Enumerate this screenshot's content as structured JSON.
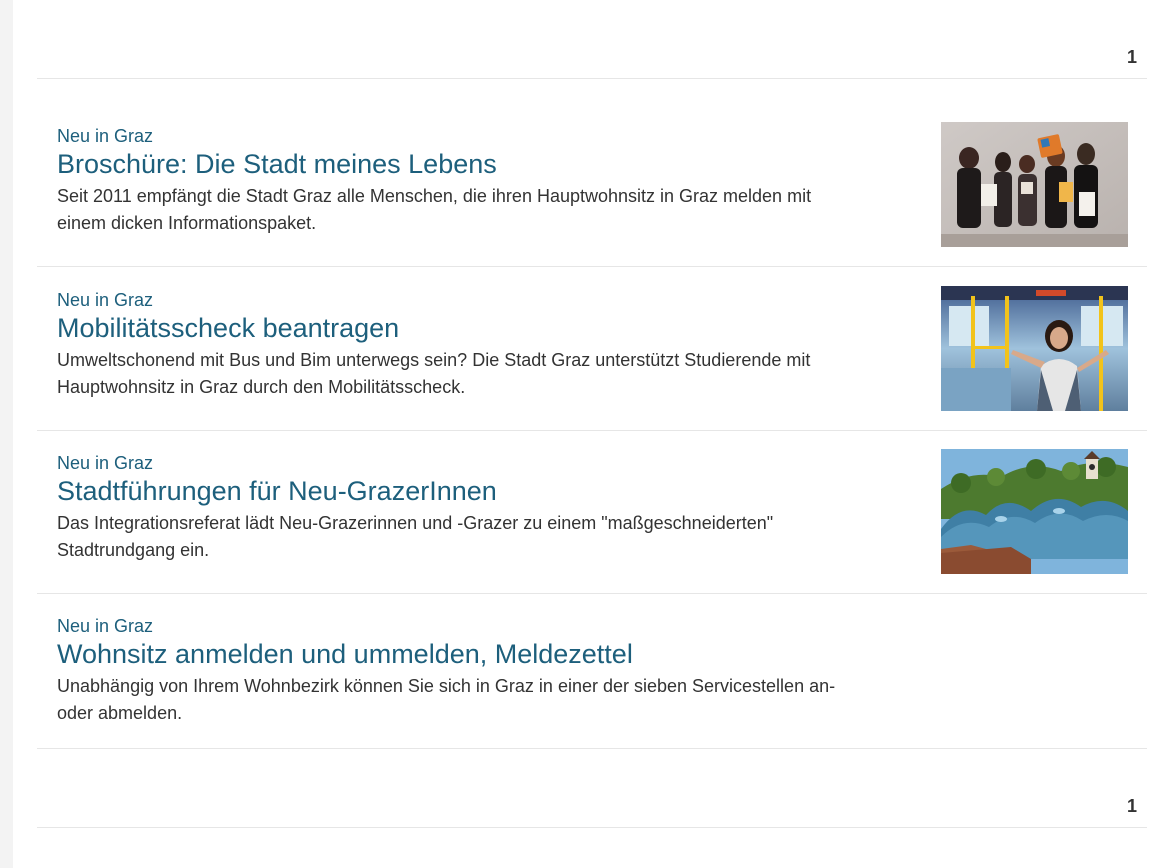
{
  "pagination": {
    "top_page": "1",
    "bottom_page": "1"
  },
  "items": [
    {
      "category": "Neu in Graz",
      "title": "Broschüre: Die Stadt meines Lebens",
      "description": "Seit 2011 empfängt die Stadt Graz alle Menschen, die ihren Hauptwohnsitz in Graz melden mit einem dicken Informationspaket.",
      "image": "group-photo-welcome-brochure"
    },
    {
      "category": "Neu in Graz",
      "title": "Mobilitätsscheck beantragen",
      "description": "Umweltschonend mit Bus und Bim unterwegs sein? Die Stadt Graz unterstützt Studierende mit Hauptwohnsitz in Graz durch den Mobilitätsscheck.",
      "image": "woman-in-tram-photo"
    },
    {
      "category": "Neu in Graz",
      "title": "Stadtführungen für Neu-GrazerInnen",
      "description": "Das Integrationsreferat lädt Neu-Grazerinnen und -Grazer zu einem \"maßgeschneiderten\" Stadtrundgang ein.",
      "image": "kunsthaus-clocktower-photo"
    },
    {
      "category": "Neu in Graz",
      "title": "Wohnsitz anmelden und ummelden, Meldezettel",
      "description": "Unabhängig von Ihrem Wohnbezirk können Sie sich in Graz in einer der sieben Servicestellen an- oder abmelden."
    }
  ],
  "colors": {
    "link": "#1d5f7c",
    "text": "#333333",
    "divider": "#e6e6e6"
  }
}
